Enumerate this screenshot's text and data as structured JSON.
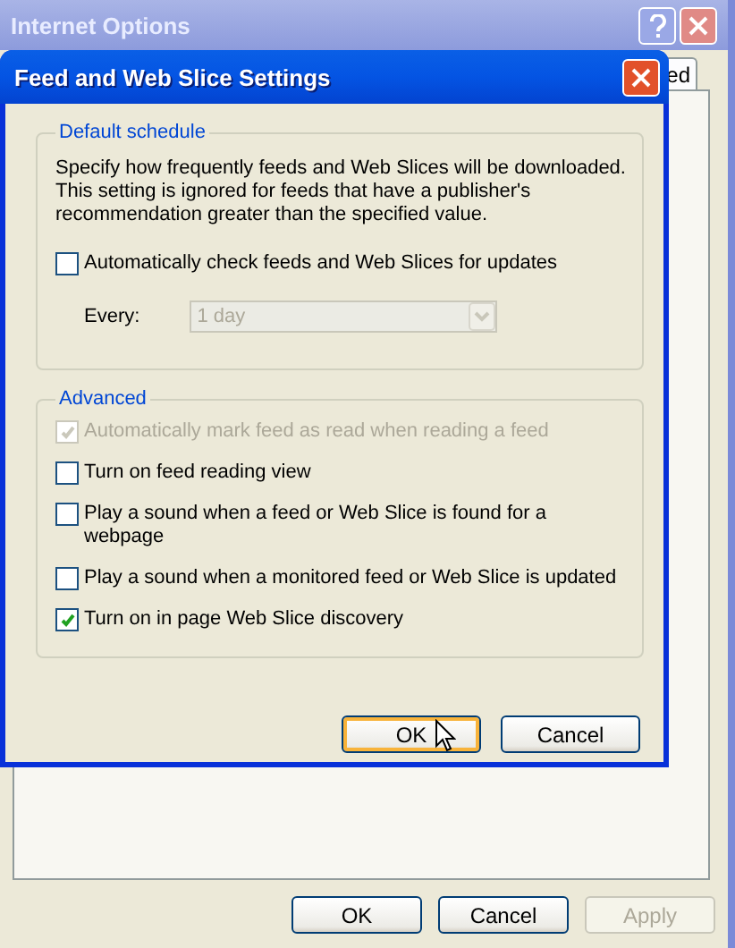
{
  "window": {
    "title": "Internet Options",
    "tab": "ed",
    "buttons": [
      {
        "label": "OK",
        "disabled": false
      },
      {
        "label": "Cancel",
        "disabled": false
      },
      {
        "label": "Apply",
        "disabled": true
      }
    ]
  },
  "dialog": {
    "title": "Feed and Web Slice Settings",
    "groups": [
      {
        "title": "Default schedule",
        "description": "Specify how frequently feeds and Web Slices will be downloaded. This setting is ignored for feeds that have a publisher's recommendation greater than the specified value.",
        "options": [
          {
            "label": "Automatically check feeds and Web Slices for updates",
            "checked": false,
            "disabled": false
          }
        ],
        "frequency": {
          "label": "Every:",
          "value": "1 day",
          "disabled": true
        }
      },
      {
        "title": "Advanced",
        "options": [
          {
            "label": "Automatically mark feed as read when reading a feed",
            "checked": true,
            "disabled": true
          },
          {
            "label": "Turn on feed reading view",
            "checked": false,
            "disabled": false
          },
          {
            "label": "Play a sound when a feed or Web Slice is found for a webpage",
            "checked": false,
            "disabled": false
          },
          {
            "label": "Play a sound when a monitored feed or Web Slice is updated",
            "checked": false,
            "disabled": false
          },
          {
            "label": "Turn on in page Web Slice discovery",
            "checked": true,
            "disabled": false
          }
        ]
      }
    ],
    "buttons": [
      {
        "label": "OK",
        "default": true
      },
      {
        "label": "Cancel",
        "default": false
      }
    ]
  }
}
